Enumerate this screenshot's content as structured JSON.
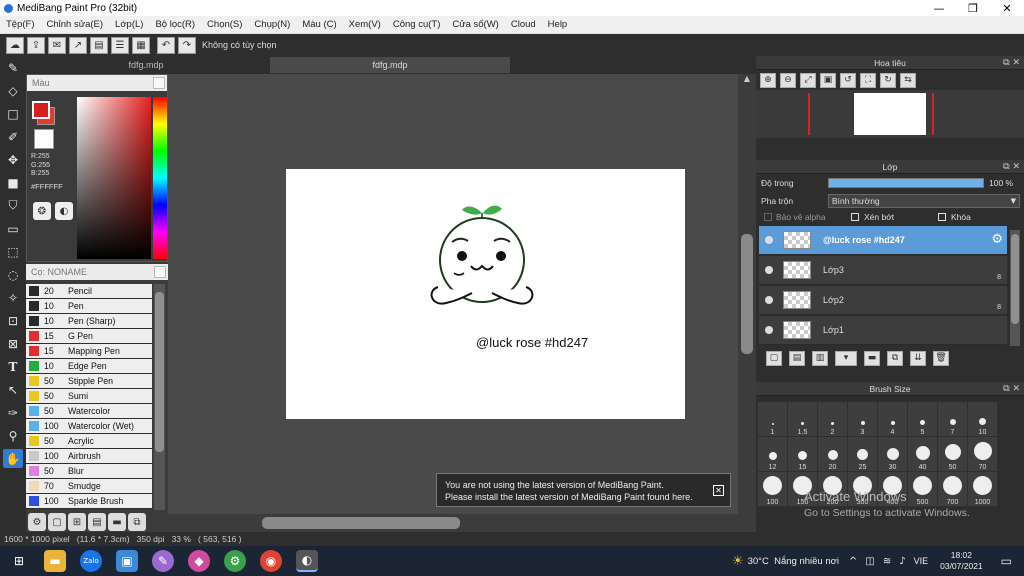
{
  "window": {
    "title": "MediBang Paint Pro (32bit)",
    "minimize": "—",
    "maximize": "❐",
    "close": "✕"
  },
  "menu": [
    "Tệp(F)",
    "Chỉnh sửa(E)",
    "Lớp(L)",
    "Bộ lọc(R)",
    "Chọn(S)",
    "Chụp(N)",
    "Màu (C)",
    "Xem(V)",
    "Công cụ(T)",
    "Cửa sổ(W)",
    "Cloud",
    "Help"
  ],
  "toolbar": {
    "no_selection": "Không có tùy chọn"
  },
  "tabs": {
    "left": "fdfg.mdp",
    "active": "fdfg.mdp"
  },
  "color_panel": {
    "title": "Màu",
    "rgb": "R:255\nG:255\nB:255",
    "hex": "#FFFFFF",
    "fg_color": "#d62020"
  },
  "brush_panel": {
    "title": "Cọ: NONAME",
    "brushes": [
      {
        "size": "20",
        "name": "Pencil",
        "color": "#2a2a2a"
      },
      {
        "size": "10",
        "name": "Pen",
        "color": "#2a2a2a"
      },
      {
        "size": "10",
        "name": "Pen (Sharp)",
        "color": "#2a2a2a"
      },
      {
        "size": "15",
        "name": "G Pen",
        "color": "#e23030"
      },
      {
        "size": "15",
        "name": "Mapping Pen",
        "color": "#e23030"
      },
      {
        "size": "10",
        "name": "Edge Pen",
        "color": "#20b040"
      },
      {
        "size": "50",
        "name": "Stipple Pen",
        "color": "#e6c820"
      },
      {
        "size": "50",
        "name": "Sumi",
        "color": "#e6c820"
      },
      {
        "size": "50",
        "name": "Watercolor",
        "color": "#5ab0e8"
      },
      {
        "size": "100",
        "name": "Watercolor (Wet)",
        "color": "#5ab0e8"
      },
      {
        "size": "50",
        "name": "Acrylic",
        "color": "#e6c820"
      },
      {
        "size": "100",
        "name": "Airbrush",
        "color": "#c8c8c8"
      },
      {
        "size": "50",
        "name": "Blur",
        "color": "#e080e0"
      },
      {
        "size": "70",
        "name": "Smudge",
        "color": "#f0d8b8"
      },
      {
        "size": "100",
        "name": "Sparkle Brush",
        "color": "#3050e0"
      }
    ]
  },
  "canvas": {
    "caption": "@luck rose #hd247"
  },
  "notification": {
    "line1": "You are not using the latest version of MediBang Paint.",
    "line2": "Please install the latest version of MediBang Paint found here."
  },
  "status": {
    "text": "1600 * 1000 pixel   (11.6 * 7.3cm)   350 dpi   33 %   ( 563, 516 )"
  },
  "navigator": {
    "title": "Hoa tiêu"
  },
  "layers_panel": {
    "title": "Lớp",
    "opacity_label": "Độ trong",
    "opacity_value": "100 %",
    "opacity": 1.0,
    "blend_label": "Pha trộn",
    "blend_value": "Bình thường",
    "protect_alpha": "Bảo vệ alpha",
    "clipping": "Xén bớt",
    "lock": "Khóa",
    "layers": [
      {
        "name": "@luck rose #hd247",
        "selected": true,
        "badge": ""
      },
      {
        "name": "Lớp3",
        "selected": false,
        "badge": "8"
      },
      {
        "name": "Lớp2",
        "selected": false,
        "badge": "8"
      },
      {
        "name": "Lớp1",
        "selected": false,
        "badge": ""
      }
    ]
  },
  "brush_size": {
    "title": "Brush Size",
    "sizes": [
      "1",
      "1.5",
      "2",
      "3",
      "4",
      "5",
      "7",
      "10",
      "12",
      "15",
      "20",
      "25",
      "30",
      "40",
      "50",
      "70",
      "100",
      "150",
      "200",
      "300",
      "400",
      "500",
      "700",
      "1000"
    ]
  },
  "watermark": {
    "line1": "Activate Windows",
    "line2": "Go to Settings to activate Windows."
  },
  "taskbar": {
    "weather": "30°C  Nắng nhiều nơi",
    "lang": "VIE",
    "time": "18:02",
    "date": "03/07/2021"
  }
}
